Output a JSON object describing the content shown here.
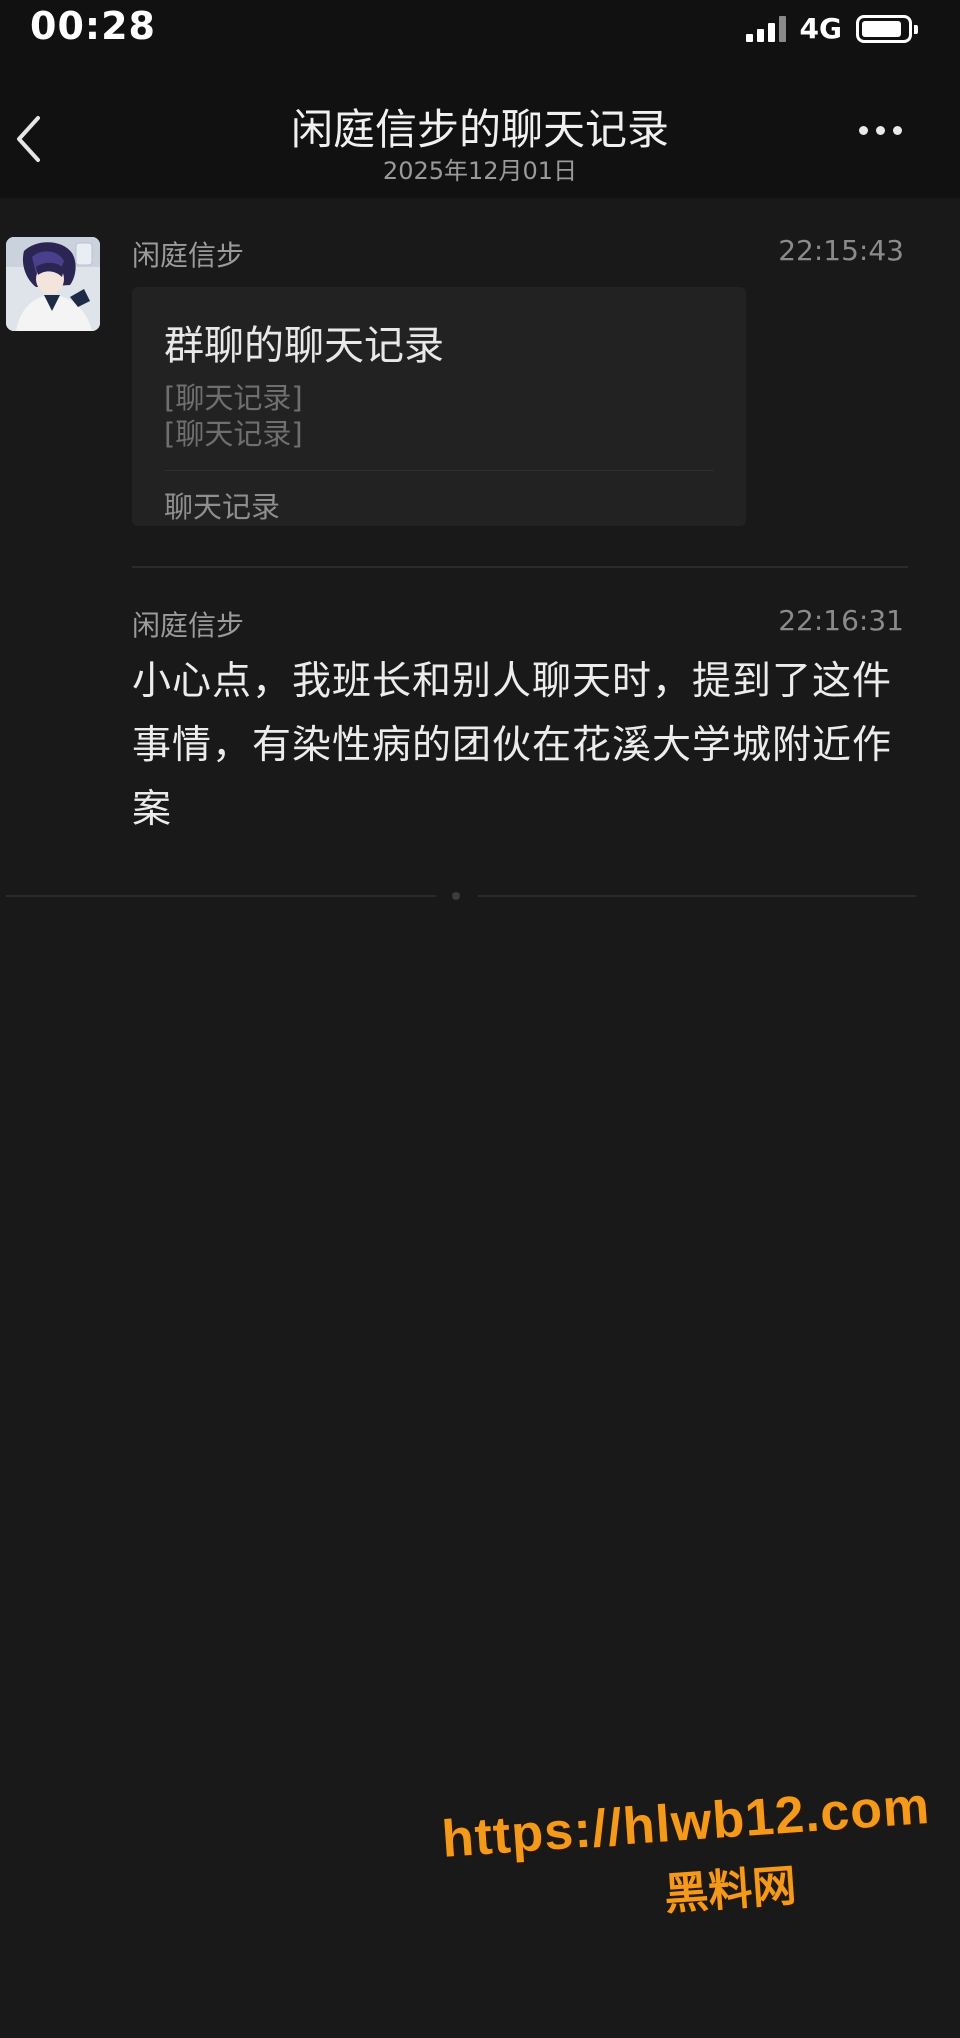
{
  "status_bar": {
    "time": "00:28",
    "network": "4G",
    "icons": [
      "signal-icon",
      "battery-icon"
    ]
  },
  "header": {
    "title": "闲庭信步的聊天记录",
    "date": "2025年12月01日",
    "back_icon": "chevron-left-icon",
    "more_icon": "more-dots-icon"
  },
  "messages": [
    {
      "sender": "闲庭信步",
      "time": "22:15:43",
      "type": "chat_record",
      "card": {
        "title": "群聊的聊天记录",
        "lines": [
          "[聊天记录]",
          "[聊天记录]"
        ],
        "footer": "聊天记录"
      }
    },
    {
      "sender": "闲庭信步",
      "time": "22:16:31",
      "type": "text",
      "text": "小心点，我班长和别人聊天时，提到了这件事情，有染性病的团伙在花溪大学城附近作案"
    }
  ],
  "watermark": {
    "url": "https://hlwb12.com",
    "name": "黑料网"
  },
  "colors": {
    "background": "#191919",
    "header_background": "#111111",
    "card_background": "#222222",
    "watermark": "#f39a1c"
  }
}
